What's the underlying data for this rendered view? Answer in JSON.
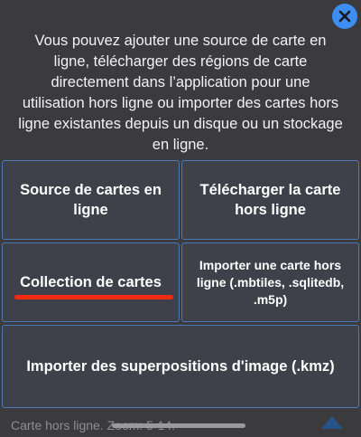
{
  "background": {
    "top_text": "",
    "bottom_text": "Carte hors ligne. Zoom: 5-14."
  },
  "dialog": {
    "intro": "Vous pouvez ajouter une source de carte en ligne, télécharger des régions de carte directement dans l’application pour une utilisation hors ligne ou importer des cartes hors ligne existantes depuis un disque ou un stockage en ligne.",
    "options": [
      {
        "label": "Source de cartes en ligne"
      },
      {
        "label": "Télécharger la carte hors ligne"
      },
      {
        "label": "Collection de cartes"
      },
      {
        "label": "Importer une carte hors ligne (.mbtiles, .sqlitedb, .m5p)"
      },
      {
        "label": "Importer des superpositions d'image (.kmz)"
      }
    ],
    "highlight_color": "#f12a12",
    "accent_color": "#3d8ef0"
  }
}
